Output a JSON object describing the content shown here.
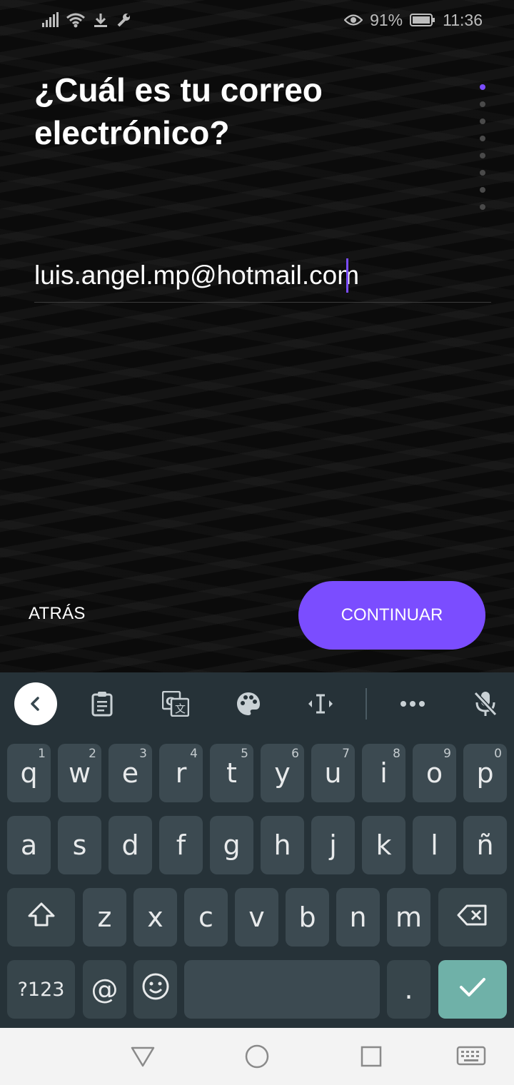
{
  "status_bar": {
    "left_icons": [
      "signal-icon",
      "wifi-icon",
      "download-icon",
      "wrench-icon"
    ],
    "battery_percent": "91%",
    "time": "11:36",
    "right_icons": [
      "eye-icon",
      "battery-icon"
    ]
  },
  "onboarding": {
    "question": "¿Cuál es tu correo electrónico?",
    "email_value": "luis.angel.mp@hotmail.com",
    "step_count": 8,
    "active_step": 1,
    "back_label": "ATRÁS",
    "continue_label": "CONTINUAR",
    "accent_color": "#7b4dff"
  },
  "keyboard": {
    "toolbar": [
      "collapse-icon",
      "clipboard-icon",
      "translate-icon",
      "palette-icon",
      "cursor-icon",
      "more-icon",
      "mic-off-icon"
    ],
    "row1": [
      {
        "k": "q",
        "h": "1"
      },
      {
        "k": "w",
        "h": "2"
      },
      {
        "k": "e",
        "h": "3"
      },
      {
        "k": "r",
        "h": "4"
      },
      {
        "k": "t",
        "h": "5"
      },
      {
        "k": "y",
        "h": "6"
      },
      {
        "k": "u",
        "h": "7"
      },
      {
        "k": "i",
        "h": "8"
      },
      {
        "k": "o",
        "h": "9"
      },
      {
        "k": "p",
        "h": "0"
      }
    ],
    "row2": [
      "a",
      "s",
      "d",
      "f",
      "g",
      "h",
      "j",
      "k",
      "l",
      "ñ"
    ],
    "row3": [
      "z",
      "x",
      "c",
      "v",
      "b",
      "n",
      "m"
    ],
    "symbols_label": "?123",
    "at_label": "@",
    "period_label": ".",
    "enter_color": "#6fb1a8"
  },
  "nav_bar": [
    "back-icon",
    "home-icon",
    "recents-icon",
    "keyboard-icon"
  ]
}
